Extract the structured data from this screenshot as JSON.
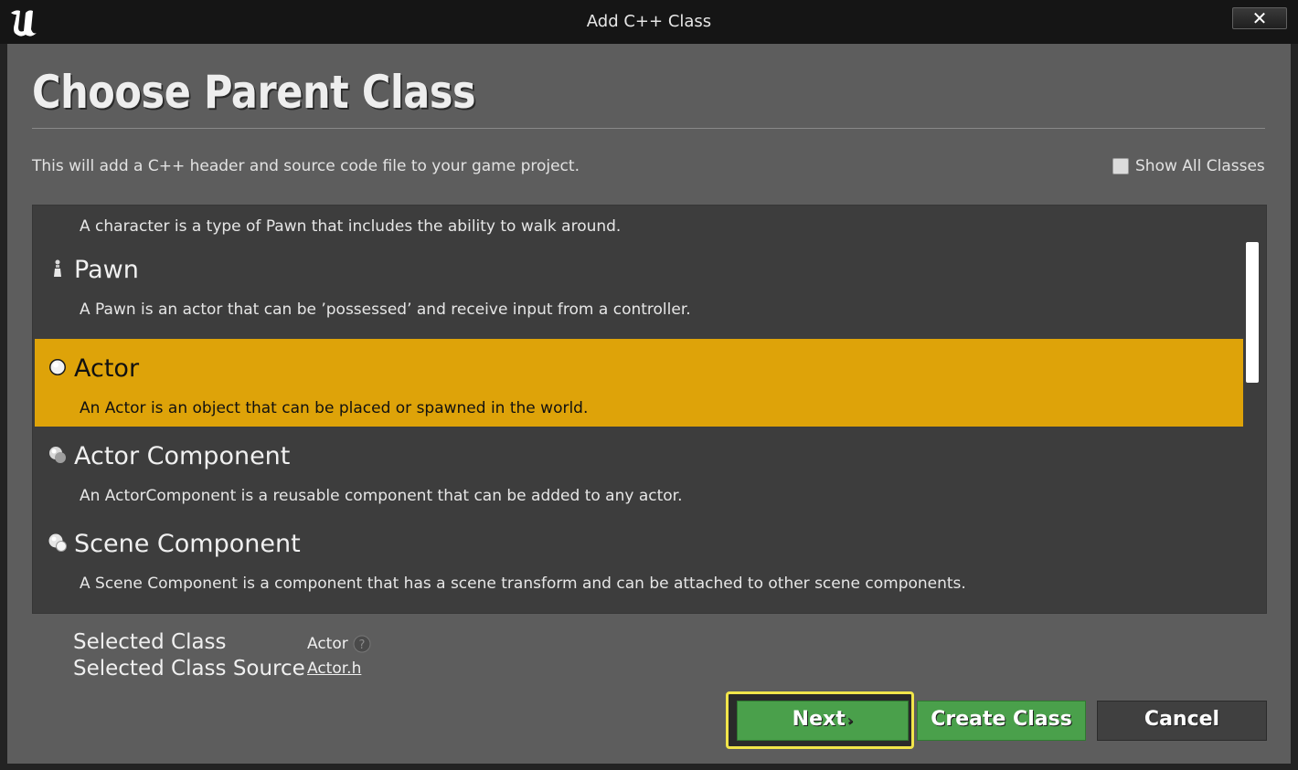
{
  "window": {
    "title": "Add C++ Class",
    "close_label": "✕"
  },
  "header": {
    "title": "Choose Parent Class",
    "description": "This will add a C++ header and source code file to your game project.",
    "show_all_label": "Show All Classes",
    "show_all_checked": false
  },
  "class_list": {
    "partial_top_desc": "A character is a type of Pawn that includes the ability to walk around.",
    "items": [
      {
        "name": "Pawn",
        "desc": "A Pawn is an actor that can be ’possessed’ and receive input from a controller.",
        "icon": "pawn-icon",
        "selected": false
      },
      {
        "name": "Actor",
        "desc": "An Actor is an object that can be placed or spawned in the world.",
        "icon": "actor-sphere-icon",
        "selected": true
      },
      {
        "name": "Actor Component",
        "desc": "An ActorComponent is a reusable component that can be added to any actor.",
        "icon": "actor-component-icon",
        "selected": false
      },
      {
        "name": "Scene Component",
        "desc": "A Scene Component is a component that has a scene transform and can be attached to other scene components.",
        "icon": "scene-component-icon",
        "selected": false
      }
    ]
  },
  "selection": {
    "class_label": "Selected Class",
    "class_value": "Actor",
    "source_label": "Selected Class Source",
    "source_value": "Actor.h"
  },
  "buttons": {
    "next": "Next",
    "create": "Create Class",
    "cancel": "Cancel"
  },
  "colors": {
    "selected_row": "#dea309",
    "green_button": "#4aa04b",
    "focus_outline": "#f1e54a"
  }
}
